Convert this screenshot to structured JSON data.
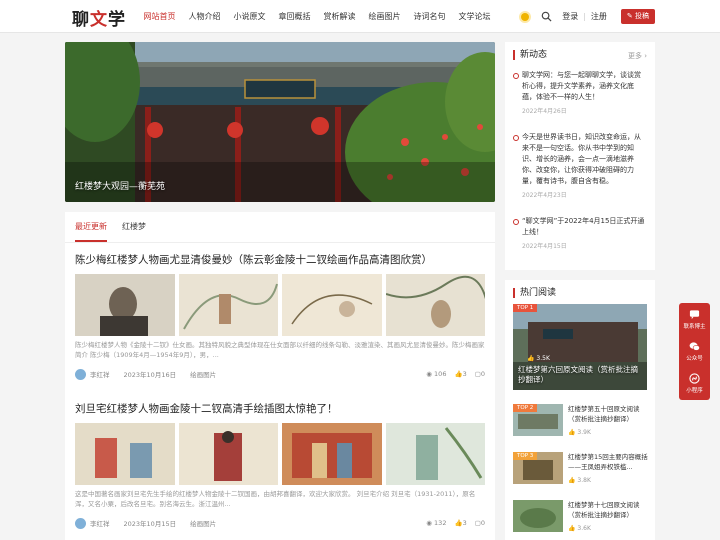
{
  "header": {
    "logo_left": "聊",
    "logo_mid": "文",
    "logo_right": "学",
    "nav": [
      "网站首页",
      "人物介绍",
      "小说原文",
      "章回概括",
      "赏析解读",
      "绘画图片",
      "诗词名句",
      "文学论坛"
    ],
    "active_index": 0,
    "login": "登录",
    "sep": "|",
    "register": "注册",
    "post_button": "投稿"
  },
  "hero": {
    "caption": "红楼梦大观园—蘅芜苑"
  },
  "tabs": [
    "最近更新",
    "红楼梦"
  ],
  "articles": [
    {
      "title": "陈少梅红楼梦人物画尤显清俊曼妙（陈云彰金陵十二钗绘画作品高清图欣赏）",
      "desc": "陈少梅红楼梦人物《金陵十二钗》仕女画。其独特风貌之典型体现在仕女面部以纤细的线条勾勒、淡雅渲染、其画风尤显清俊曼妙。陈少梅画家简介 陈少梅（1909年4月—1954年9月），男，...",
      "author": "李红祥",
      "date": "2023年10月16日",
      "category": "绘画图片",
      "views": "106",
      "likes": "3",
      "comments": "0"
    },
    {
      "title": "刘旦宅红楼梦人物画金陵十二钗高清手绘插图太惊艳了！",
      "desc": "这是中国著名画家刘旦宅先生手绘的红楼梦人物金陵十二钗国画，由胡邦喜翻译，欢迎大家欣赏。 刘旦宅介绍 刘旦宅（1931-2011），原名浑，又名小粟，后改名旦宅。别名海云生。浙江温州...",
      "author": "李红祥",
      "date": "2023年10月15日",
      "category": "绘画图片",
      "views": "132",
      "likes": "3",
      "comments": "0"
    }
  ],
  "news": {
    "title": "新动态",
    "more": "更多 ›",
    "items": [
      {
        "text": "聊文学网：与您一起聊聊文学，谈谈赏析心得，提升文学素养，涵养文化底蕴，体验不一样的人生！",
        "date": "2022年4月26日"
      },
      {
        "text": "今天是世界读书日，知识改变命运，从来不是一句空话。你从书中学到的知识、增长的涵养，会一点一滴地滋养你、改变你，让你获得冲破阻碍的力量，覆有诗书，腹自含有稳。",
        "date": "2022年4月23日"
      },
      {
        "text": "“聊文学网”于2022年4月15日正式开通上线！",
        "date": "2022年4月15日"
      }
    ]
  },
  "hot": {
    "title": "热门阅读",
    "items": [
      {
        "rank": "TOP 1",
        "title": "红楼梦第六回原文阅读（赏析批注摘抄翻译）",
        "views": "3.5K"
      },
      {
        "rank": "TOP 2",
        "title": "红楼梦第五十回原文阅读（赏析批注摘抄翻译）",
        "views": "3.9K"
      },
      {
        "rank": "TOP 3",
        "title": "红楼梦第15回主要内容概括——王凤姐弄权铁槛...",
        "views": "3.8K"
      },
      {
        "rank": "",
        "title": "红楼梦第十七回原文阅读（赏析批注摘抄翻译）",
        "views": "3.6K"
      }
    ]
  },
  "float": [
    "联系博主",
    "公众号",
    "小程序"
  ],
  "colors": {
    "accent": "#c9302c"
  }
}
